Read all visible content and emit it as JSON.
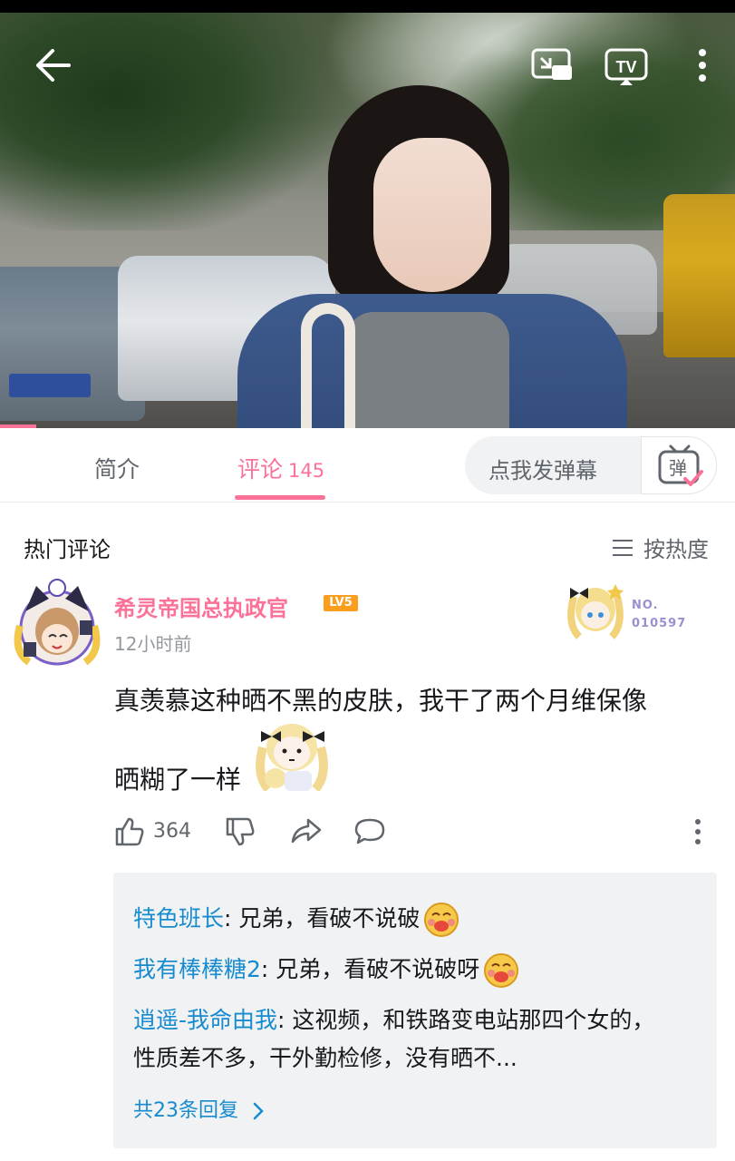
{
  "colors": {
    "accent": "#fb7299",
    "reply_link": "#178bcf",
    "level_badge": "#fb9e1e"
  },
  "video": {
    "icons": [
      "back-icon",
      "picture-in-picture-icon",
      "tv-cast-icon",
      "more-vertical-icon"
    ]
  },
  "tabs": {
    "intro_label": "简介",
    "comments_label": "评论",
    "comments_count": "145",
    "danmaku_placeholder": "点我发弹幕",
    "danmaku_button_glyph": "弹"
  },
  "comments_header": {
    "title": "热门评论",
    "sort_label": "按热度"
  },
  "comment": {
    "username": "希灵帝国总执政官",
    "level": "LV5",
    "time": "12小时前",
    "fan_badge_label": "NO.",
    "fan_badge_number": "010597",
    "text_line1": "真羡慕这种晒不黑的皮肤，我干了两个月维保像",
    "text_line2": "晒糊了一样",
    "like_count": "364"
  },
  "replies": [
    {
      "user": "特色班长",
      "text": ": 兄弟，看破不说破"
    },
    {
      "user": "我有棒棒糖2",
      "text": ": 兄弟，看破不说破呀"
    },
    {
      "user": "逍遥-我命由我",
      "text": ": 这视频，和铁路变电站那四个女的，性质差不多，干外勤检修，没有晒不..."
    }
  ],
  "more_replies": "共23条回复"
}
